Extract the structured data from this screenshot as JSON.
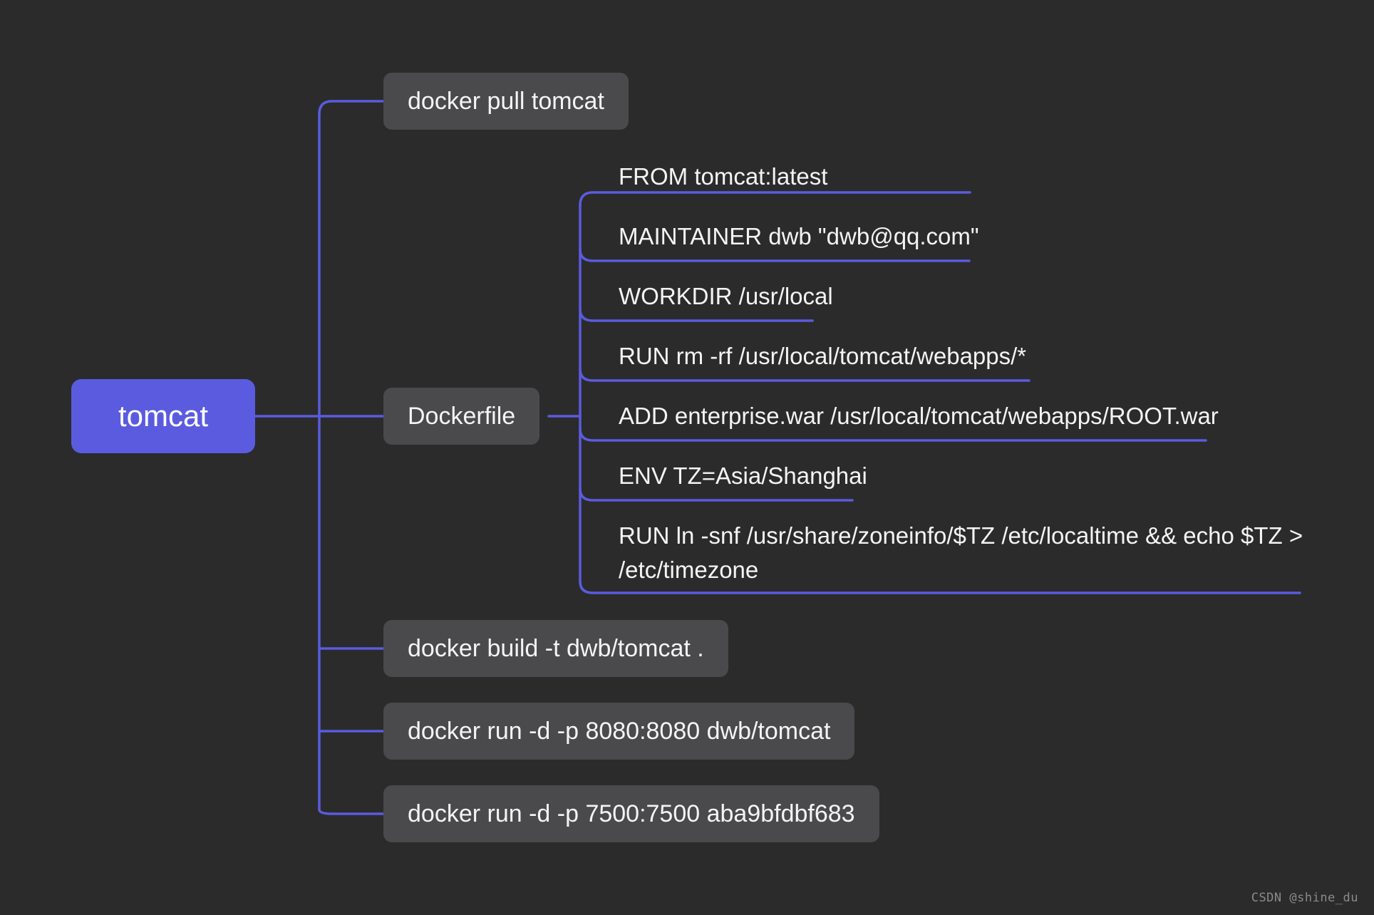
{
  "diagram": {
    "type": "mindmap",
    "title": "tomcat",
    "background_color": "#2b2b2b",
    "accent_color": "#5b5be0",
    "node_color": "#4a4a4d",
    "text_color": "#f4f4f5"
  },
  "root": {
    "label": "tomcat"
  },
  "branches": [
    {
      "label": "docker pull tomcat"
    },
    {
      "label": "Dockerfile"
    },
    {
      "label": "docker build -t dwb/tomcat ."
    },
    {
      "label": "docker run -d -p 8080:8080 dwb/tomcat"
    },
    {
      "label": "docker run -d -p 7500:7500 aba9bfdbf683"
    }
  ],
  "dockerfile_lines": [
    {
      "label": "FROM tomcat:latest"
    },
    {
      "label": "MAINTAINER dwb \"dwb@qq.com\""
    },
    {
      "label": "WORKDIR /usr/local"
    },
    {
      "label": "RUN rm -rf /usr/local/tomcat/webapps/*"
    },
    {
      "label": "ADD enterprise.war /usr/local/tomcat/webapps/ROOT.war"
    },
    {
      "label": "ENV TZ=Asia/Shanghai"
    },
    {
      "label": "RUN ln -snf /usr/share/zoneinfo/$TZ /etc/localtime && echo $TZ > /etc/timezone"
    }
  ],
  "watermark": {
    "label": "CSDN @shine_du"
  }
}
